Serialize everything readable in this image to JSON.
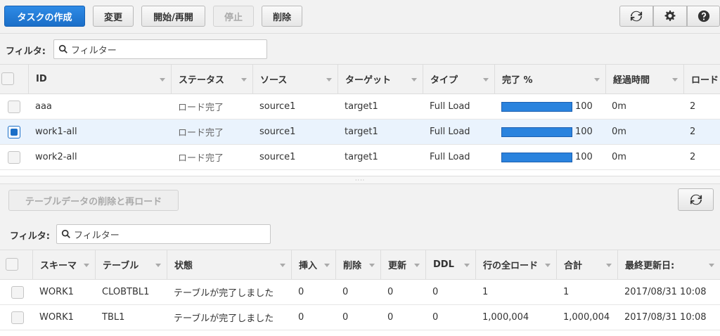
{
  "toolbar": {
    "create_task": "タスクの作成",
    "modify": "変更",
    "start_resume": "開始/再開",
    "stop": "停止",
    "delete": "削除",
    "icons": [
      "refresh-icon",
      "gear-icon",
      "help-icon"
    ]
  },
  "task_filter": {
    "label": "フィルタ:",
    "placeholder": "フィルター"
  },
  "task_table": {
    "columns": [
      "ID",
      "ステータス",
      "ソース",
      "ターゲット",
      "タイプ",
      "完了 %",
      "経過時間",
      "ロード"
    ],
    "rows": [
      {
        "id": "aaa",
        "status": "ロード完了",
        "source": "source1",
        "target": "target1",
        "type": "Full Load",
        "progress": 100,
        "progress_label": "100",
        "elapsed": "0m",
        "load": "2",
        "selected": false
      },
      {
        "id": "work1-all",
        "status": "ロード完了",
        "source": "source1",
        "target": "target1",
        "type": "Full Load",
        "progress": 100,
        "progress_label": "100",
        "elapsed": "0m",
        "load": "2",
        "selected": true
      },
      {
        "id": "work2-all",
        "status": "ロード完了",
        "source": "source1",
        "target": "target1",
        "type": "Full Load",
        "progress": 100,
        "progress_label": "100",
        "elapsed": "0m",
        "load": "2",
        "selected": false
      }
    ]
  },
  "lower_toolbar": {
    "reload_tables": "テーブルデータの削除と再ロード"
  },
  "table_filter": {
    "label": "フィルタ:",
    "placeholder": "フィルター"
  },
  "table_stats": {
    "columns": [
      "スキーマ",
      "テーブル",
      "状態",
      "挿入",
      "削除",
      "更新",
      "DDL",
      "行の全ロード",
      "合計",
      "最終更新日:"
    ],
    "rows": [
      {
        "schema": "WORK1",
        "table": "CLOBTBL1",
        "state": "テーブルが完了しました",
        "inserts": "0",
        "deletes": "0",
        "updates": "0",
        "ddl": "0",
        "full_load_rows": "1",
        "total": "1",
        "last_updated": "2017/08/31 10:08"
      },
      {
        "schema": "WORK1",
        "table": "TBL1",
        "state": "テーブルが完了しました",
        "inserts": "0",
        "deletes": "0",
        "updates": "0",
        "ddl": "0",
        "full_load_rows": "1,000,004",
        "total": "1,000,004",
        "last_updated": "2017/08/31 10:08"
      }
    ]
  },
  "colors": {
    "primary": "#1b6fc8",
    "progress_fill": "#2a83de",
    "selected_row": "#eaf3fd"
  }
}
